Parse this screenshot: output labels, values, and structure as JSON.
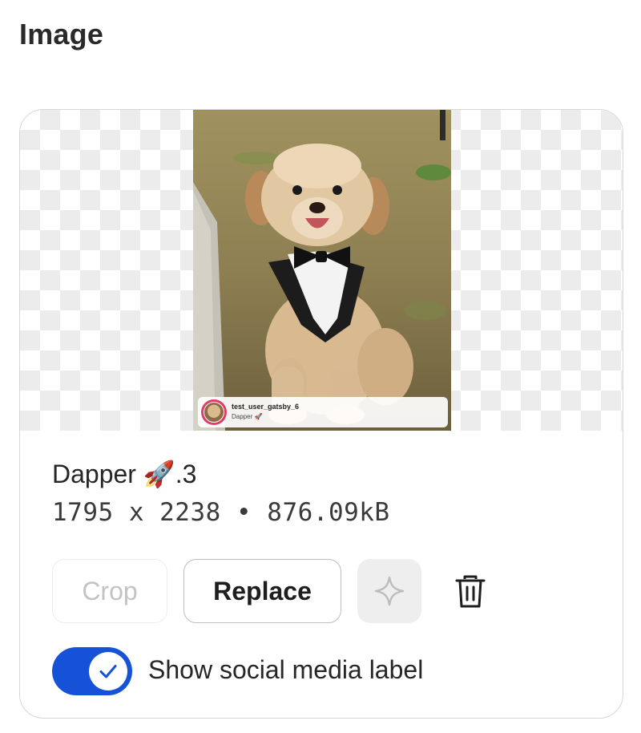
{
  "section": {
    "title": "Image"
  },
  "preview": {
    "social_label": {
      "username": "test_user_gatsby_6",
      "caption": "Dapper 🚀"
    }
  },
  "file": {
    "name": "Dapper 🚀.3",
    "meta": "1795 x 2238 • 876.09kB"
  },
  "actions": {
    "crop_label": "Crop",
    "crop_disabled": true,
    "replace_label": "Replace",
    "ai_icon": "sparkle-icon",
    "delete_icon": "trash-icon"
  },
  "social_toggle": {
    "label": "Show social media label",
    "checked": true
  },
  "colors": {
    "toggle_on": "#1652d8",
    "checkerboard": "#ececec",
    "border": "#d6d6d6"
  }
}
